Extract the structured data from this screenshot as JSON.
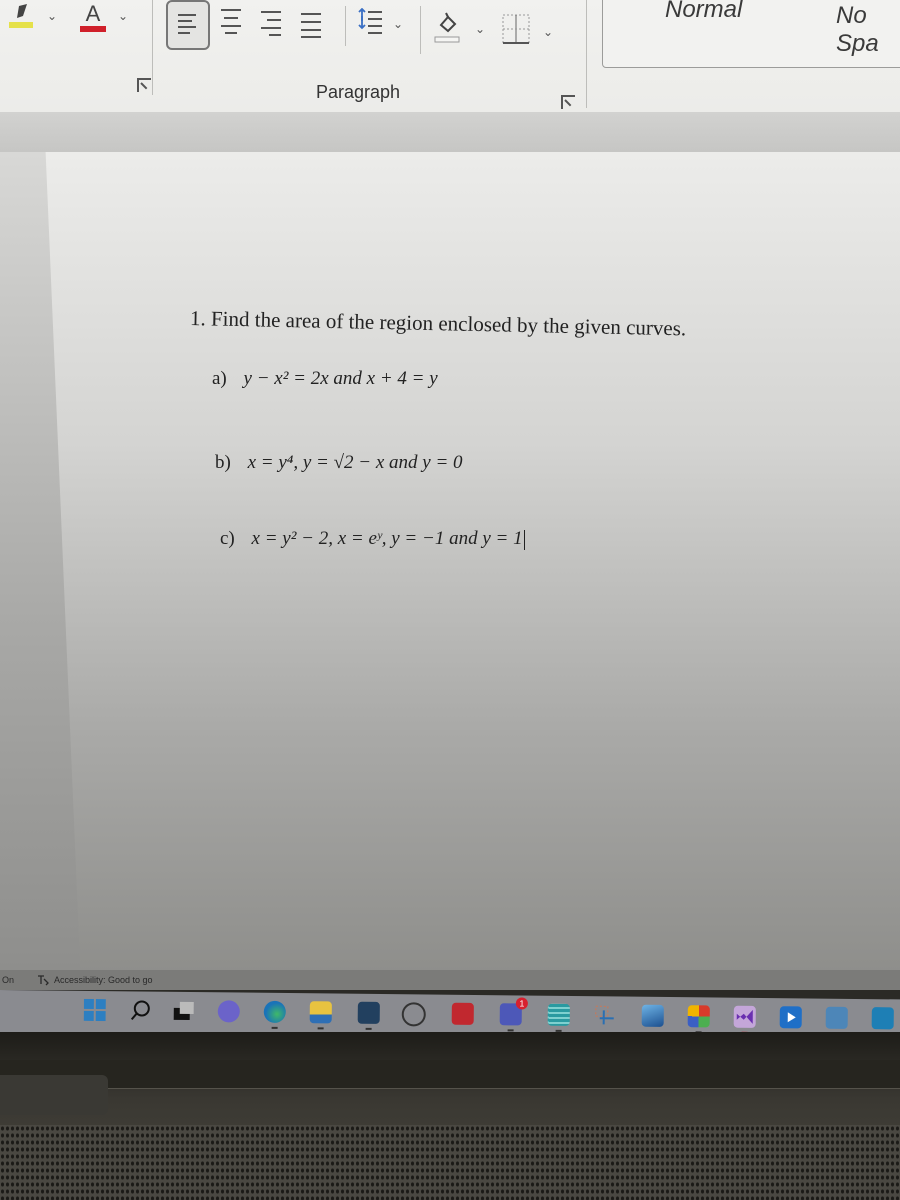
{
  "ribbon": {
    "font_group": {
      "highlight_color": "#e5e14a",
      "font_color_letter": "A",
      "font_color": "#d0202a"
    },
    "paragraph_group": {
      "label": "Paragraph"
    },
    "styles_group": {
      "items": [
        "Normal",
        "No Spa"
      ]
    }
  },
  "document": {
    "question_title": "1.  Find the area of the region enclosed by the given curves.",
    "items": [
      {
        "label": "a)",
        "expr": "y − x² = 2x and x + 4 = y"
      },
      {
        "label": "b)",
        "expr": "x = y⁴, y = √2 − x and y = 0"
      },
      {
        "label": "c)",
        "expr": "x = y² − 2, x = eʸ, y = −1 and y = 1"
      }
    ]
  },
  "statusbar": {
    "left_text": "On",
    "accessibility": "Accessibility: Good to go"
  },
  "taskbar": {
    "icons": [
      "windows-start",
      "search",
      "task-view",
      "teams-chat",
      "edge",
      "file-explorer",
      "microsoft-store",
      "dell",
      "mcafee",
      "teams",
      "notepad",
      "snipping-tool",
      "photos",
      "office",
      "visual-studio",
      "media-player",
      "app-blue-1",
      "app-blue-2"
    ],
    "teams_badge": "1"
  }
}
